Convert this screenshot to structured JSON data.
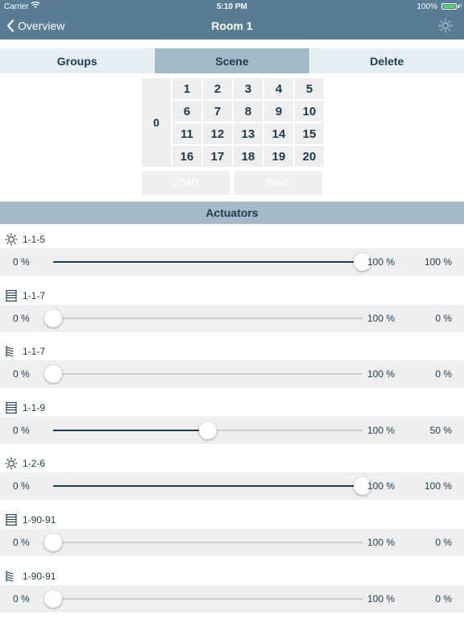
{
  "status_bar": {
    "carrier": "Carrier",
    "time": "5:10 PM",
    "battery": "100%"
  },
  "nav": {
    "back_label": "Overview",
    "title": "Room 1"
  },
  "tabs": [
    {
      "label": "Groups",
      "active": false
    },
    {
      "label": "Scene",
      "active": true
    },
    {
      "label": "Delete",
      "active": false
    }
  ],
  "scene": {
    "zero": "0",
    "numbers": [
      "1",
      "2",
      "3",
      "4",
      "5",
      "6",
      "7",
      "8",
      "9",
      "10",
      "11",
      "12",
      "13",
      "14",
      "15",
      "16",
      "17",
      "18",
      "19",
      "20"
    ],
    "load_label": "LOAD",
    "save_label": "SAVE"
  },
  "actuators_title": "Actuators",
  "actuators": [
    {
      "name": "1-1-5",
      "icon": "sun-icon",
      "min": "0 %",
      "max": "100 %",
      "value_label": "100 %",
      "value": 100
    },
    {
      "name": "1-1-7",
      "icon": "blind-icon",
      "min": "0 %",
      "max": "100 %",
      "value_label": "0 %",
      "value": 0
    },
    {
      "name": "1-1-7",
      "icon": "slat-icon",
      "min": "0 %",
      "max": "100 %",
      "value_label": "0 %",
      "value": 0
    },
    {
      "name": "1-1-9",
      "icon": "blind-icon",
      "min": "0 %",
      "max": "100 %",
      "value_label": "50 %",
      "value": 50
    },
    {
      "name": "1-2-6",
      "icon": "sun-icon",
      "min": "0 %",
      "max": "100 %",
      "value_label": "100 %",
      "value": 100
    },
    {
      "name": "1-90-91",
      "icon": "blind-icon",
      "min": "0 %",
      "max": "100 %",
      "value_label": "0 %",
      "value": 0
    },
    {
      "name": "1-90-91",
      "icon": "slat-icon",
      "min": "0 %",
      "max": "100 %",
      "value_label": "0 %",
      "value": 0
    }
  ]
}
